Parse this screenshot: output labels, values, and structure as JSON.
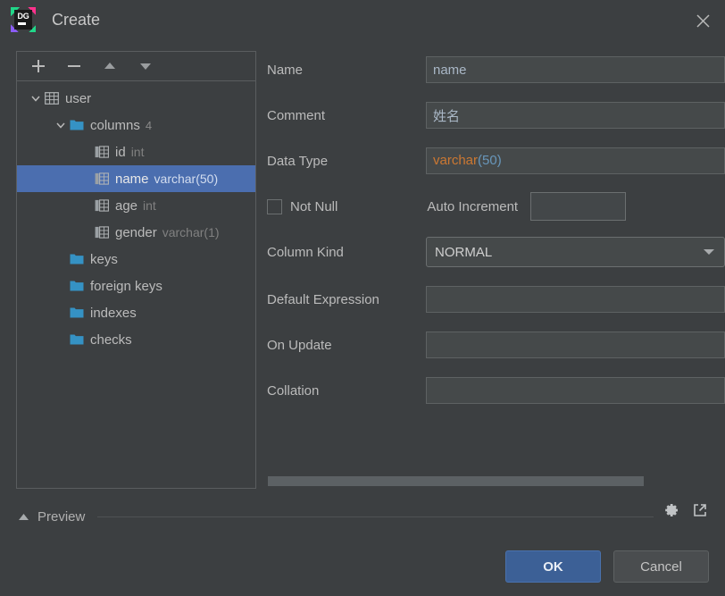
{
  "window": {
    "title": "Create",
    "logo_text": "DG",
    "close_icon": "close-icon"
  },
  "tree_toolbar": {
    "add_label": "+",
    "remove_label": "−",
    "move_up_label": "▲",
    "move_down_label": "▼"
  },
  "tree": {
    "nodes": [
      {
        "label": "user",
        "sub": "",
        "count": "",
        "icon": "table-icon",
        "depth": 0,
        "expanded": true,
        "selected": false
      },
      {
        "label": "columns",
        "sub": "",
        "count": "4",
        "icon": "folder-icon",
        "depth": 1,
        "expanded": true,
        "selected": false
      },
      {
        "label": "id",
        "sub": "int",
        "count": "",
        "icon": "column-icon",
        "depth": 2,
        "expanded": null,
        "selected": false
      },
      {
        "label": "name",
        "sub": "varchar(50)",
        "count": "",
        "icon": "column-icon",
        "depth": 2,
        "expanded": null,
        "selected": true
      },
      {
        "label": "age",
        "sub": "int",
        "count": "",
        "icon": "column-icon",
        "depth": 2,
        "expanded": null,
        "selected": false
      },
      {
        "label": "gender",
        "sub": "varchar(1)",
        "count": "",
        "icon": "column-icon",
        "depth": 2,
        "expanded": null,
        "selected": false
      },
      {
        "label": "keys",
        "sub": "",
        "count": "",
        "icon": "folder-icon",
        "depth": 1,
        "expanded": null,
        "selected": false
      },
      {
        "label": "foreign keys",
        "sub": "",
        "count": "",
        "icon": "folder-icon",
        "depth": 1,
        "expanded": null,
        "selected": false
      },
      {
        "label": "indexes",
        "sub": "",
        "count": "",
        "icon": "folder-icon",
        "depth": 1,
        "expanded": null,
        "selected": false
      },
      {
        "label": "checks",
        "sub": "",
        "count": "",
        "icon": "folder-icon",
        "depth": 1,
        "expanded": null,
        "selected": false
      }
    ]
  },
  "form": {
    "name_label": "Name",
    "name_value": "name",
    "comment_label": "Comment",
    "comment_value": "姓名",
    "data_type_label": "Data Type",
    "data_type_base": "varchar",
    "data_type_args": "(50)",
    "not_null_label": "Not Null",
    "not_null_checked": false,
    "auto_increment_label": "Auto Increment",
    "auto_increment_value": "",
    "column_kind_label": "Column Kind",
    "column_kind_value": "NORMAL",
    "default_expression_label": "Default Expression",
    "default_expression_value": "",
    "on_update_label": "On Update",
    "on_update_value": "",
    "collation_label": "Collation",
    "collation_value": ""
  },
  "preview": {
    "label": "Preview",
    "toggle_icon": "triangle-up-icon",
    "settings_icon": "gear-icon",
    "open_editor_icon": "external-link-icon"
  },
  "footer": {
    "ok_label": "OK",
    "cancel_label": "Cancel"
  },
  "colors": {
    "background": "#3c3f41",
    "selection": "#4b6eaf",
    "accent_button": "#3c6096",
    "folder_icon": "#3592c4",
    "type_keyword": "#cc7832",
    "type_number": "#6897bb"
  }
}
